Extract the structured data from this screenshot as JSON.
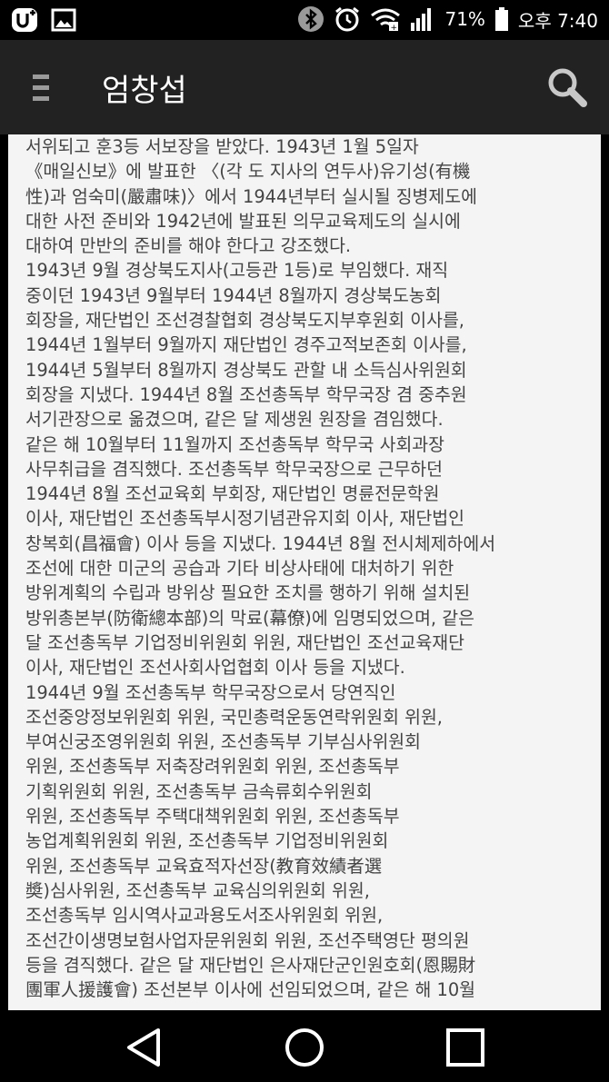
{
  "status_bar": {
    "battery_percent": "71%",
    "clock": "오후 7:40",
    "icons": [
      "u-plus-icon",
      "gallery-icon",
      "bluetooth-icon",
      "alarm-icon",
      "wifi-icon",
      "signal-icon",
      "battery-icon"
    ]
  },
  "app_bar": {
    "title": "엄창섭",
    "menu_icon": "hamburger-menu-icon",
    "search_icon": "search-icon"
  },
  "article": {
    "lines": [
      "서위되고 훈3등 서보장을 받았다. 1943년 1월 5일자",
      "《매일신보》에 발표한 〈(각 도 지사의 연두사)유기성(有機",
      "性)과 엄숙미(嚴肅味)〉에서 1944년부터 실시될 징병제도에",
      "대한 사전 준비와 1942년에 발표된 의무교육제도의 실시에",
      "대하여 만반의 준비를 해야 한다고 강조했다.",
      "1943년 9월 경상북도지사(고등관 1등)로 부임했다. 재직",
      "중이던 1943년 9월부터 1944년 8월까지 경상북도농회",
      "회장을, 재단법인 조선경찰협회 경상북도지부후원회 이사를,",
      "1944년 1월부터 9월까지 재단법인 경주고적보존회 이사를,",
      "1944년 5월부터 8월까지 경상북도 관할 내 소득심사위원회",
      "회장을 지냈다. 1944년 8월 조선총독부 학무국장 겸 중추원",
      "서기관장으로 옮겼으며, 같은 달 제생원 원장을 겸임했다.",
      "같은 해 10월부터 11월까지 조선총독부 학무국 사회과장",
      "사무취급을 겸직했다. 조선총독부 학무국장으로 근무하던",
      "1944년 8월 조선교육회 부회장, 재단법인 명륜전문학원",
      "이사, 재단법인 조선총독부시정기념관유지회 이사, 재단법인",
      "창복회(昌福會) 이사 등을 지냈다. 1944년 8월 전시체제하에서",
      "조선에 대한 미군의 공습과 기타 비상사태에 대처하기 위한",
      "방위계획의 수립과 방위상 필요한 조치를 행하기 위해 설치된",
      "방위총본부(防衛總本部)의 막료(幕僚)에 임명되었으며, 같은",
      "달 조선총독부 기업정비위원회 위원, 재단법인 조선교육재단",
      "이사, 재단법인 조선사회사업협회 이사 등을 지냈다.",
      "1944년 9월 조선총독부 학무국장으로서 당연직인",
      "조선중앙정보위원회 위원, 국민총력운동연락위원회 위원,",
      "부여신궁조영위원회 위원, 조선총독부 기부심사위원회",
      "위원, 조선총독부 저축장려위원회 위원, 조선총독부",
      "기획위원회 위원, 조선총독부 금속류회수위원회",
      "위원, 조선총독부 주택대책위원회 위원, 조선총독부",
      "농업계획위원회 위원, 조선총독부 기업정비위원회",
      "위원, 조선총독부 교육효적자선장(教育效績者選",
      "奬)심사위원, 조선총독부 교육심의위원회 위원,",
      "조선총독부 임시역사교과용도서조사위원회 위원,",
      "조선간이생명보험사업자문위원회 위원, 조선주택영단 평의원",
      "등을 겸직했다. 같은 달 재단법인 은사재단군인원호회(恩賜財",
      "團軍人援護會) 조선본부 이사에 선임되었으며, 같은 해 10월"
    ]
  },
  "nav_bar": {
    "back_icon": "back-triangle-icon",
    "home_icon": "home-circle-icon",
    "recents_icon": "recents-square-icon"
  }
}
